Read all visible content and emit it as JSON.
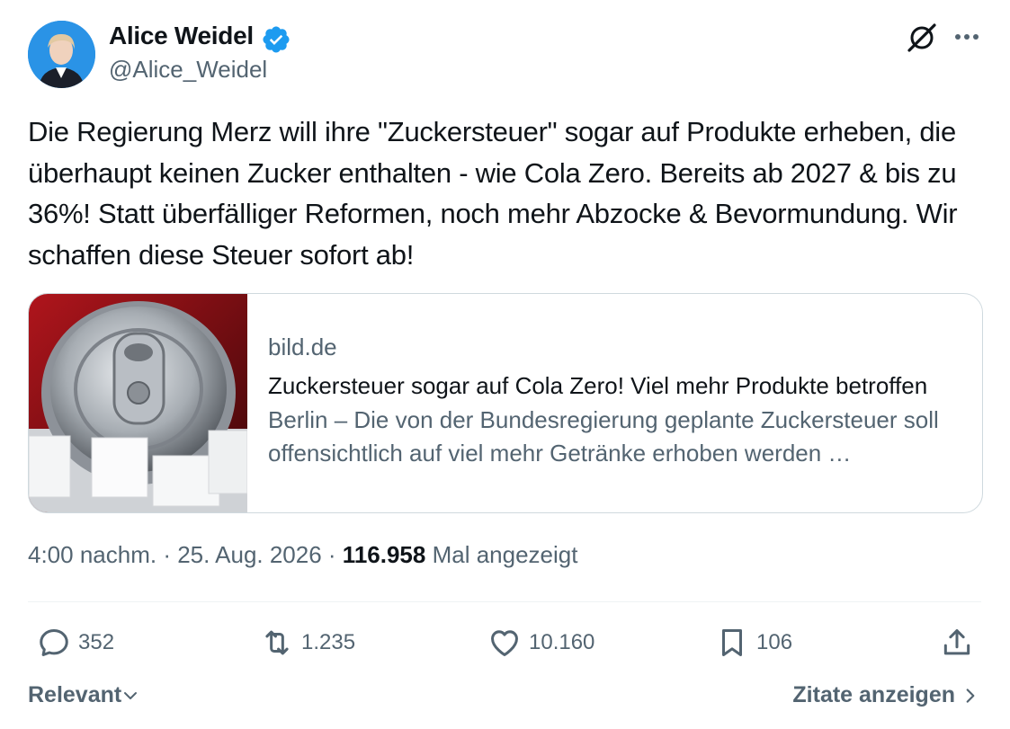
{
  "author": {
    "name": "Alice Weidel",
    "handle": "@Alice_Weidel",
    "verified": true,
    "verified_color": "#1d9bf0"
  },
  "tweet": {
    "text": "Die Regierung Merz will ihre \"Zuckersteuer\" sogar auf Produkte erheben, die überhaupt keinen Zucker enthalten - wie Cola Zero. Bereits ab 2027 & bis zu 36%! Statt überfälliger Reformen, noch mehr Abzocke & Bevormundung. Wir schaffen diese Steuer sofort ab!"
  },
  "link_card": {
    "domain": "bild.de",
    "title": "Zuckersteuer sogar auf Cola Zero! Viel mehr Produkte betroffen",
    "description": "Berlin – Die von der Bundesregierung geplante Zuckersteuer soll offensichtlich auf viel mehr Getränke erhoben werden …",
    "image_icon": "soda-can-sugar-cubes-image"
  },
  "meta": {
    "time": "4:00 nachm.",
    "separator": " · ",
    "date": "25. Aug. 2026",
    "views": "116.958",
    "views_label": "Mal angezeigt"
  },
  "actions": {
    "replies": "352",
    "reposts": "1.235",
    "likes": "10.160",
    "bookmarks": "106"
  },
  "footer": {
    "sort_label": "Relevant",
    "quotes_label": "Zitate anzeigen"
  },
  "icons": {
    "grok": "grok-icon",
    "more": "more-options-icon",
    "reply": "reply-icon",
    "repost": "repost-icon",
    "like": "heart-icon",
    "bookmark": "bookmark-icon",
    "share": "share-icon"
  },
  "colors": {
    "text": "#0f1419",
    "secondary": "#536471",
    "border": "#cfd9de",
    "accent": "#1d9bf0"
  }
}
